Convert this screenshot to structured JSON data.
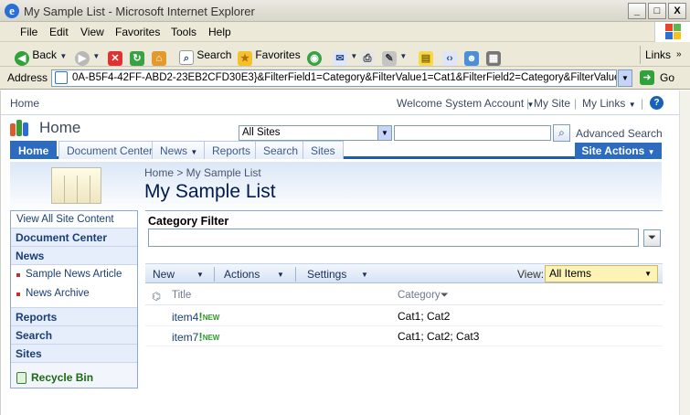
{
  "window": {
    "title": "My Sample List - Microsoft Internet Explorer",
    "buttons": {
      "minimize": "_",
      "maximize": "□",
      "close": "X"
    }
  },
  "menu": [
    "File",
    "Edit",
    "View",
    "Favorites",
    "Tools",
    "Help"
  ],
  "toolbar": {
    "back": "Back",
    "search": "Search",
    "favorites": "Favorites",
    "links": "Links"
  },
  "address": {
    "label": "Address",
    "url": "0A-B5F4-42FF-ABD2-23EB2CFD30E3}&FilterField1=Category&FilterValue1=Cat1&FilterField2=Category&FilterValue2=Cat2",
    "go": "Go"
  },
  "topnav": {
    "home": "Home",
    "welcome": "Welcome System Account",
    "my_site": "My Site",
    "my_links": "My Links"
  },
  "site": {
    "title": "Home",
    "scope": "All Sites",
    "advanced_search": "Advanced Search",
    "tabs": [
      "Home",
      "Document Center",
      "News",
      "Reports",
      "Search",
      "Sites"
    ],
    "site_actions": "Site Actions"
  },
  "page": {
    "breadcrumb": "Home > My Sample List",
    "title": "My Sample List"
  },
  "leftnav": {
    "view_all": "View All Site Content",
    "document_center": "Document Center",
    "news": "News",
    "news_items": [
      "Sample News Article",
      "News Archive"
    ],
    "reports": "Reports",
    "search": "Search",
    "sites": "Sites",
    "recycle_bin": "Recycle Bin"
  },
  "filter": {
    "title": "Category Filter",
    "value": ""
  },
  "list_toolbar": {
    "new": "New",
    "actions": "Actions",
    "settings": "Settings",
    "view_label": "View:",
    "view_value": "All Items"
  },
  "table": {
    "columns": [
      "Title",
      "Category"
    ],
    "new_badge": "NEW",
    "rows": [
      {
        "title": "item4",
        "category": "Cat1; Cat2"
      },
      {
        "title": "item7",
        "category": "Cat1; Cat2; Cat3"
      }
    ]
  }
}
